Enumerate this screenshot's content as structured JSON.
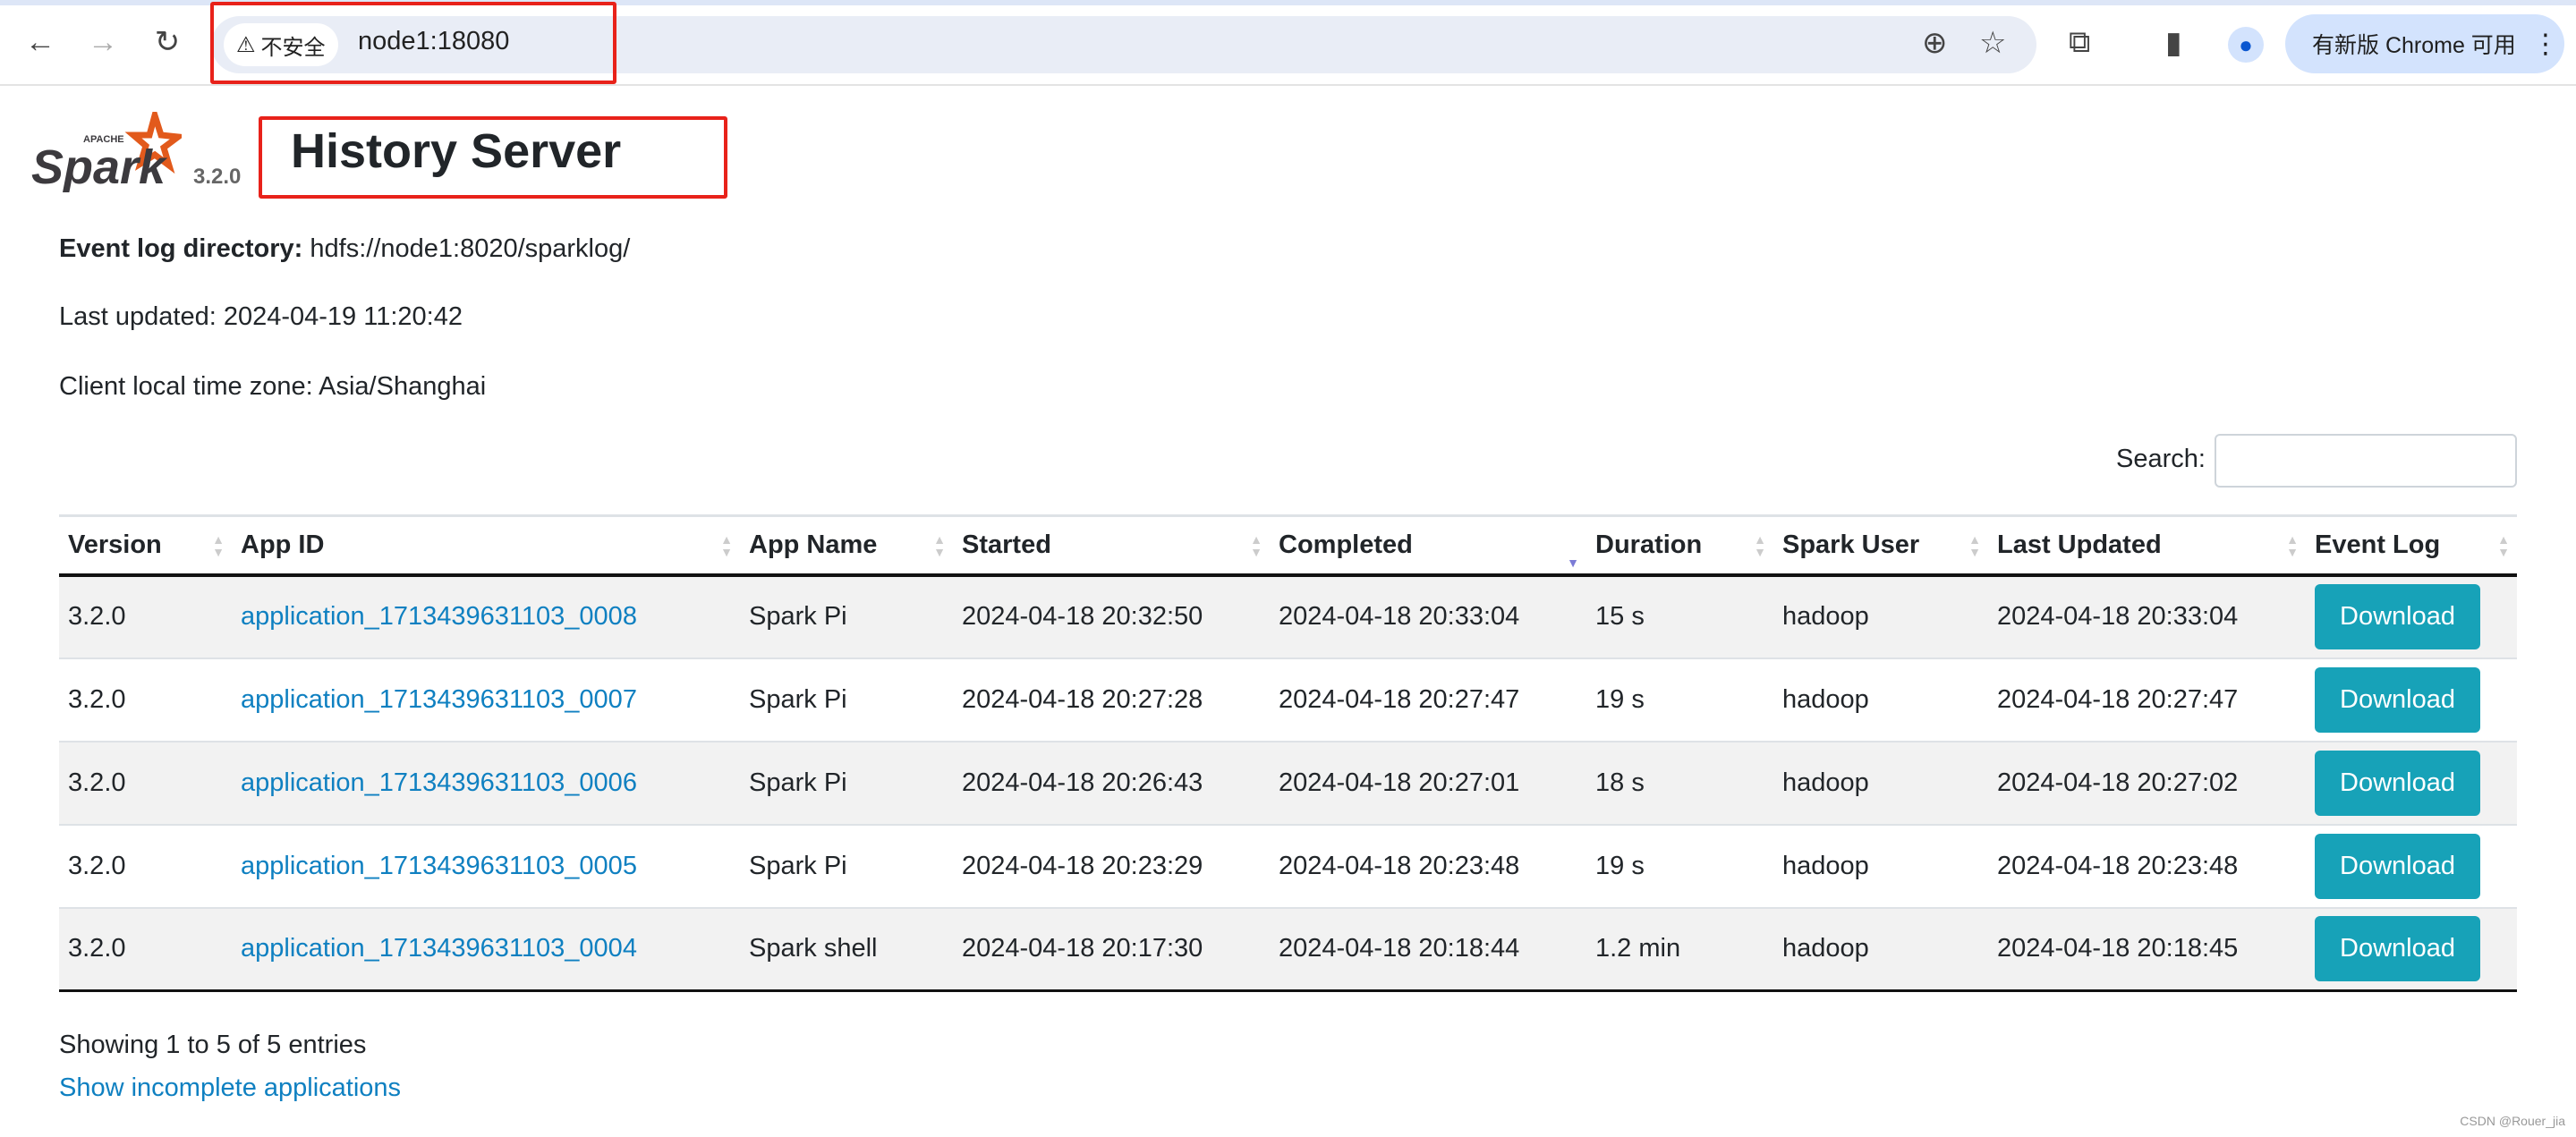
{
  "browser": {
    "security_label": "不安全",
    "url": "node1:18080",
    "update_label": "有新版 Chrome 可用"
  },
  "header": {
    "title": "History Server",
    "version": "3.2.0",
    "logo_text": "APACHE Spark"
  },
  "info": {
    "event_log_label": "Event log directory:",
    "event_log_value": "hdfs://node1:8020/sparklog/",
    "last_updated": "Last updated: 2024-04-19 11:20:42",
    "timezone": "Client local time zone: Asia/Shanghai"
  },
  "search": {
    "label": "Search:",
    "value": ""
  },
  "table": {
    "columns": [
      "Version",
      "App ID",
      "App Name",
      "Started",
      "Completed",
      "Duration",
      "Spark User",
      "Last Updated",
      "Event Log"
    ],
    "sorted_column": "Completed",
    "sort_direction": "descending",
    "rows": [
      {
        "version": "3.2.0",
        "app_id": "application_1713439631103_0008",
        "app_name": "Spark Pi",
        "started": "2024-04-18 20:32:50",
        "completed": "2024-04-18 20:33:04",
        "duration": "15 s",
        "user": "hadoop",
        "last_updated": "2024-04-18 20:33:04",
        "event_log": "Download"
      },
      {
        "version": "3.2.0",
        "app_id": "application_1713439631103_0007",
        "app_name": "Spark Pi",
        "started": "2024-04-18 20:27:28",
        "completed": "2024-04-18 20:27:47",
        "duration": "19 s",
        "user": "hadoop",
        "last_updated": "2024-04-18 20:27:47",
        "event_log": "Download"
      },
      {
        "version": "3.2.0",
        "app_id": "application_1713439631103_0006",
        "app_name": "Spark Pi",
        "started": "2024-04-18 20:26:43",
        "completed": "2024-04-18 20:27:01",
        "duration": "18 s",
        "user": "hadoop",
        "last_updated": "2024-04-18 20:27:02",
        "event_log": "Download"
      },
      {
        "version": "3.2.0",
        "app_id": "application_1713439631103_0005",
        "app_name": "Spark Pi",
        "started": "2024-04-18 20:23:29",
        "completed": "2024-04-18 20:23:48",
        "duration": "19 s",
        "user": "hadoop",
        "last_updated": "2024-04-18 20:23:48",
        "event_log": "Download"
      },
      {
        "version": "3.2.0",
        "app_id": "application_1713439631103_0004",
        "app_name": "Spark shell",
        "started": "2024-04-18 20:17:30",
        "completed": "2024-04-18 20:18:44",
        "duration": "1.2 min",
        "user": "hadoop",
        "last_updated": "2024-04-18 20:18:45",
        "event_log": "Download"
      }
    ]
  },
  "footer": {
    "showing": "Showing 1 to 5 of 5 entries",
    "incomplete_link": "Show incomplete applications",
    "watermark": "CSDN @Rouer_jia"
  },
  "colors": {
    "accent_link": "#0f80c1",
    "download_button": "#17a2b8",
    "highlight_box": "#e8221a"
  }
}
